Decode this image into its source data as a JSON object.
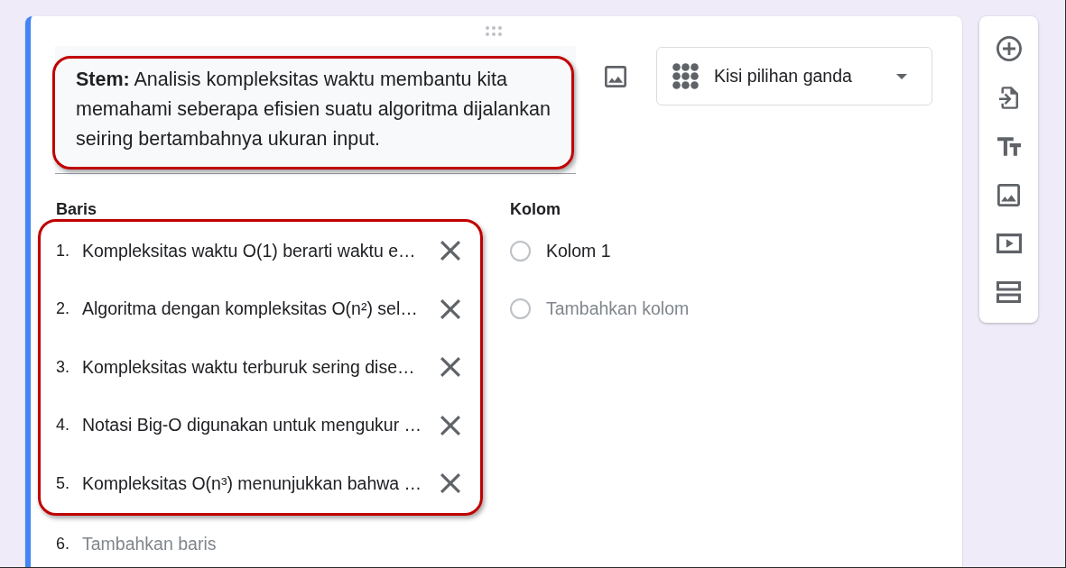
{
  "question": {
    "stem": {
      "text": "**Stem:** Analisis kompleksitas waktu membantu kita memahami seberapa efisien suatu algoritma dijalankan seiring bertambahnya ukuran input.",
      "highlighted": true
    },
    "type": {
      "label": "Kisi pilihan ganda"
    }
  },
  "rows": {
    "label": "Baris",
    "highlighted": true,
    "items": [
      {
        "number": "1.",
        "text": "Kompleksitas waktu O(1) berarti waktu e…"
      },
      {
        "number": "2.",
        "text": "Algoritma dengan kompleksitas O(n²) sel…"
      },
      {
        "number": "3.",
        "text": "Kompleksitas waktu terburuk sering dise…"
      },
      {
        "number": "4.",
        "text": "Notasi Big-O digunakan untuk mengukur …"
      },
      {
        "number": "5.",
        "text": "Kompleksitas O(n³) menunjukkan bahwa …"
      }
    ],
    "add": {
      "number": "6.",
      "text": "Tambahkan baris"
    }
  },
  "columns": {
    "label": "Kolom",
    "items": [
      {
        "text": "Kolom 1"
      }
    ],
    "add": {
      "text": "Tambahkan kolom"
    }
  }
}
